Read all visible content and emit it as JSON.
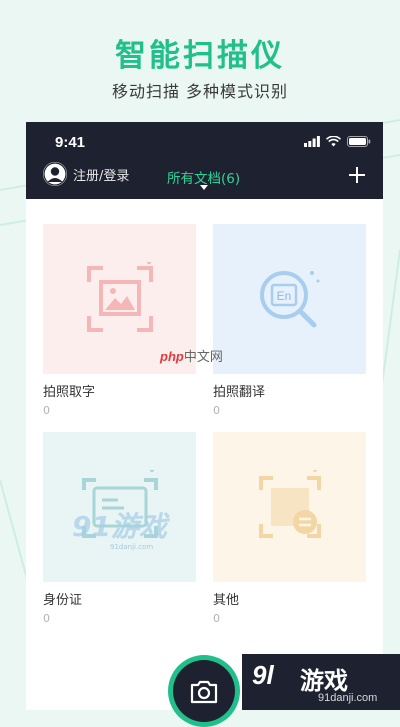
{
  "promo": {
    "title": "智能扫描仪",
    "subtitle": "移动扫描 多种模式识别"
  },
  "status_bar": {
    "time": "9:41",
    "icons": [
      "signal-icon",
      "wifi-icon",
      "battery-icon"
    ]
  },
  "header": {
    "login_label": "注册/登录",
    "tab_label": "所有文档(6)",
    "add_icon": "plus-icon"
  },
  "categories": [
    {
      "label": "拍照取字",
      "count": "0",
      "icon": "image-scan-icon",
      "bg": "#fdeeee",
      "accent": "#f4b6b6"
    },
    {
      "label": "拍照翻译",
      "count": "0",
      "icon": "translate-search-icon",
      "bg": "#e6f1fc",
      "accent": "#a9cdee"
    },
    {
      "label": "身份证",
      "count": "0",
      "icon": "id-card-icon",
      "bg": "#e8f5f4",
      "accent": "#a8d5d7"
    },
    {
      "label": "其他",
      "count": "0",
      "icon": "document-scan-icon",
      "bg": "#fdf5e8",
      "accent": "#f3d6a4"
    }
  ],
  "translate_icon_text": "En",
  "watermarks": {
    "php_brand": "php",
    "php_cn": "中文网",
    "mid_91": "91游戏",
    "mid_91_url": "91danji.com",
    "corner_91": "9l",
    "corner_cn": "游戏",
    "corner_url": "91danji.com"
  },
  "colors": {
    "accent": "#21c08b",
    "appbar": "#1e2230",
    "background": "#eaf7f3"
  },
  "camera_button": {
    "icon": "camera-icon"
  }
}
